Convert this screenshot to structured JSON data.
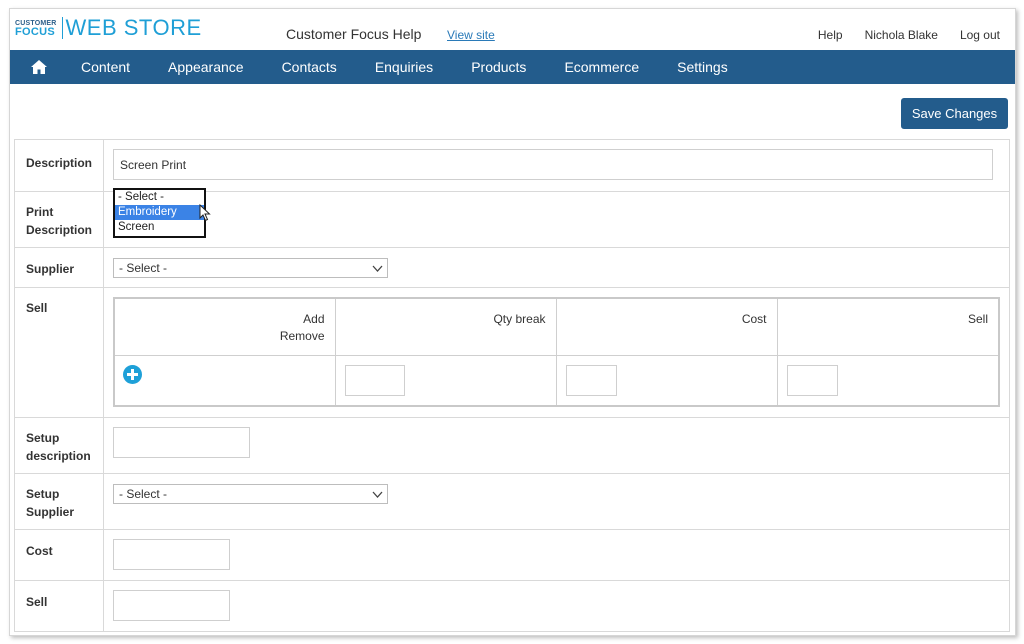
{
  "logo": {
    "line1": "CUSTOMER",
    "line2": "FOCUS",
    "name": "WEB STORE"
  },
  "header": {
    "site_title": "Customer Focus Help",
    "view_site": "View site",
    "help": "Help",
    "user": "Nichola Blake",
    "logout": "Log out"
  },
  "nav": {
    "home_icon": "home-icon",
    "items": [
      "Content",
      "Appearance",
      "Contacts",
      "Enquiries",
      "Products",
      "Ecommerce",
      "Settings"
    ]
  },
  "toolbar": {
    "save_label": "Save Changes"
  },
  "form": {
    "description": {
      "label": "Description",
      "value": "Screen Print"
    },
    "print_description": {
      "label_line1": "Print",
      "label_line2": "Description",
      "options": [
        "- Select -",
        "Embroidery",
        "Screen"
      ],
      "highlighted": "Embroidery"
    },
    "supplier": {
      "label": "Supplier",
      "value": "- Select -"
    },
    "sell_grid": {
      "label": "Sell",
      "col_add": "Add",
      "col_remove": "Remove",
      "col_qty": "Qty break",
      "col_cost": "Cost",
      "col_sell": "Sell",
      "add_icon": "plus-circle-icon"
    },
    "setup_description": {
      "label_line1": "Setup",
      "label_line2": "description"
    },
    "setup_supplier": {
      "label_line1": "Setup",
      "label_line2": "Supplier",
      "value": "- Select -"
    },
    "cost": {
      "label": "Cost"
    },
    "sell": {
      "label": "Sell"
    }
  },
  "colors": {
    "brand": "#235c8c",
    "logo_blue": "#1f9fd6",
    "link": "#2a7ab8",
    "highlight": "#3b83e6"
  }
}
